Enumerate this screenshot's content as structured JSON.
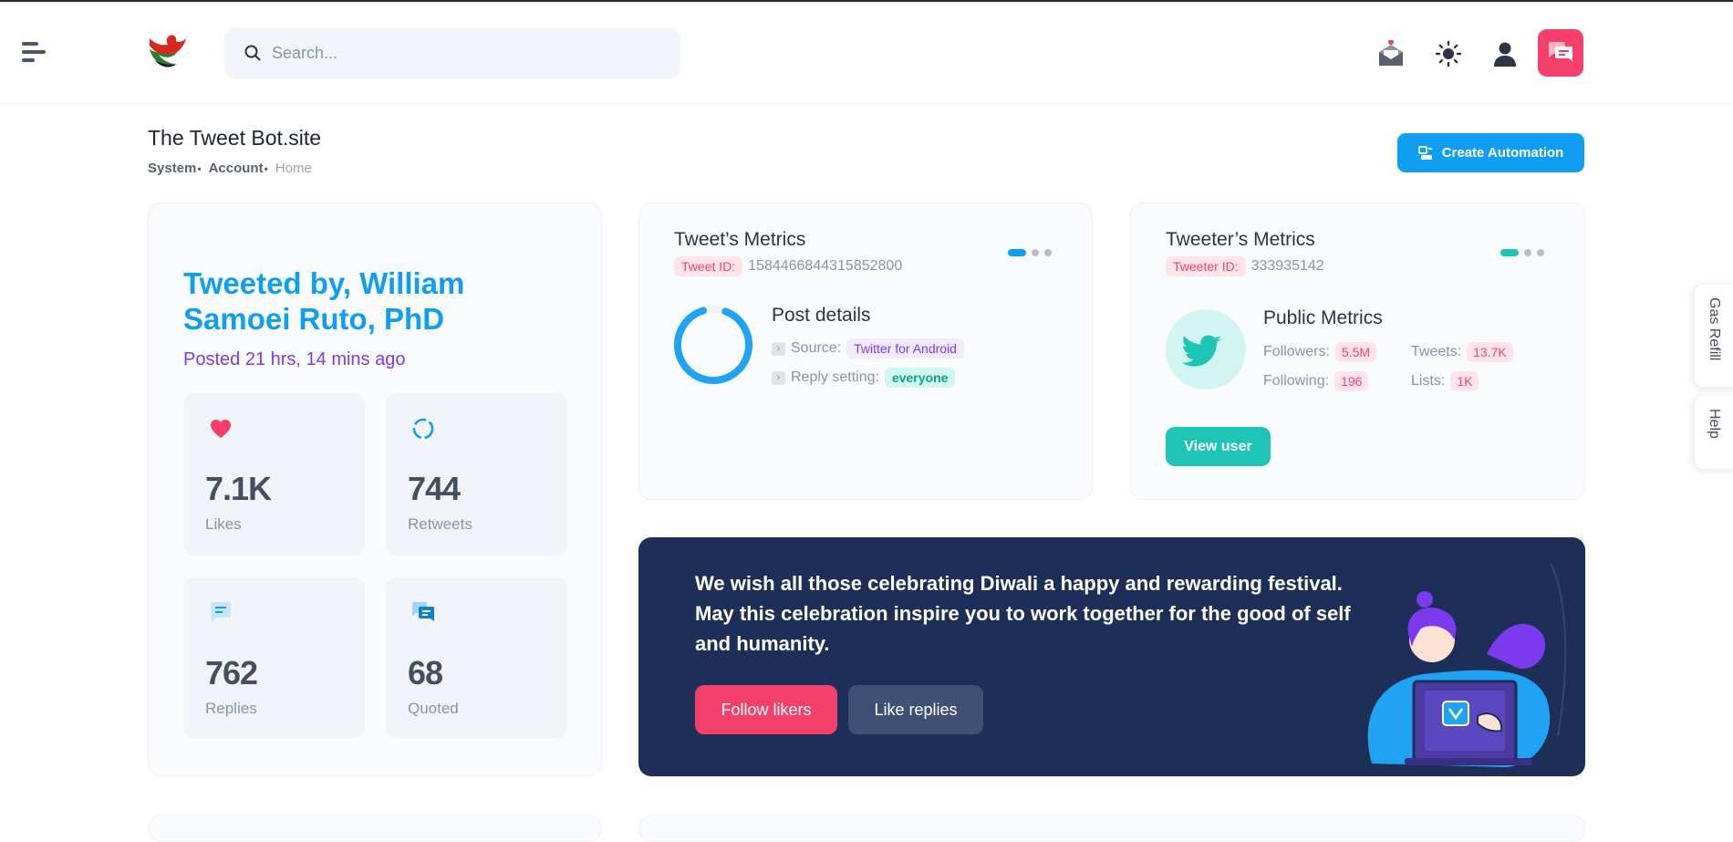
{
  "header": {
    "search": {
      "placeholder": "Search..."
    },
    "icons": [
      "menu-icon",
      "bird-logo-icon",
      "search-icon",
      "mail-icon",
      "sun-icon",
      "user-icon",
      "chat-icon"
    ]
  },
  "page": {
    "title": "The Tweet Bot.site",
    "breadcrumb": [
      "System",
      "Account",
      "Home"
    ],
    "create_button": "Create Automation"
  },
  "tweet_card": {
    "heading": "Tweeted by, William Samoei Ruto, PhD",
    "posted": "Posted 21 hrs, 14 mins ago",
    "stats": [
      {
        "value": "7.1K",
        "label": "Likes",
        "icon": "heart-icon"
      },
      {
        "value": "744",
        "label": "Retweets",
        "icon": "retweet-icon"
      },
      {
        "value": "762",
        "label": "Replies",
        "icon": "reply-icon"
      },
      {
        "value": "68",
        "label": "Quoted",
        "icon": "quote-icon"
      }
    ]
  },
  "tweet_metrics": {
    "title": "Tweet’s Metrics",
    "id_label": "Tweet ID:",
    "id_value": "1584466844315852800",
    "post_details": "Post details",
    "source_label": "Source:",
    "source_value": "Twitter for Android",
    "reply_label": "Reply setting:",
    "reply_value": "everyone"
  },
  "tweeter_metrics": {
    "title": "Tweeter’s Metrics",
    "id_label": "Tweeter ID:",
    "id_value": "333935142",
    "public_metrics": "Public Metrics",
    "followers_label": "Followers:",
    "followers_value": "5.5M",
    "following_label": "Following:",
    "following_value": "196",
    "tweets_label": "Tweets:",
    "tweets_value": "13.7K",
    "lists_label": "Lists:",
    "lists_value": "1K",
    "view_button": "View user"
  },
  "banner": {
    "message": "We wish all those celebrating Diwali a happy and rewarding festival. May this celebration inspire you to work together for the good of self and humanity.",
    "follow_button": "Follow likers",
    "like_button": "Like replies"
  },
  "side_tabs": {
    "gas": "Gas Refill",
    "help": "Help"
  },
  "colors": {
    "accent": "#0f9ef2",
    "pink": "#f43f6a",
    "teal": "#1ec5b5",
    "purple": "#7c3aed",
    "banner": "#1d2f58"
  }
}
